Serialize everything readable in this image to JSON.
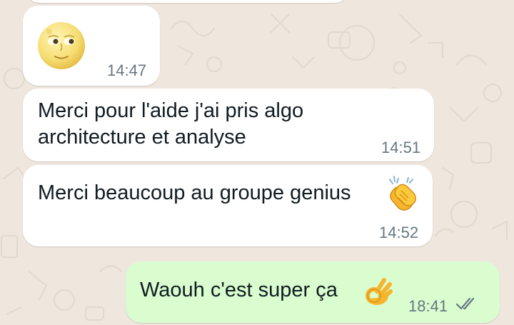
{
  "chat": {
    "messages": [
      {
        "direction": "incoming",
        "content": "moon-face-emoji",
        "time": "14:47"
      },
      {
        "direction": "incoming",
        "text_line1": "Merci pour l'aide j'ai pris algo",
        "text_line2": "architecture et analyse",
        "time": "14:51"
      },
      {
        "direction": "incoming",
        "text": "Merci beaucoup au groupe genius",
        "emoji": "clapping-hands-emoji",
        "time": "14:52"
      },
      {
        "direction": "outgoing",
        "text": "Waouh c'est super ça",
        "emoji": "ok-hand-emoji",
        "time": "18:41",
        "status": "read-double-check"
      }
    ]
  },
  "colors": {
    "wallpaper": "#efe7de",
    "incoming_bubble": "#ffffff",
    "outgoing_bubble": "#dafdd0",
    "text": "#111b21",
    "timestamp": "#667781",
    "read_ticks": "#667781"
  }
}
